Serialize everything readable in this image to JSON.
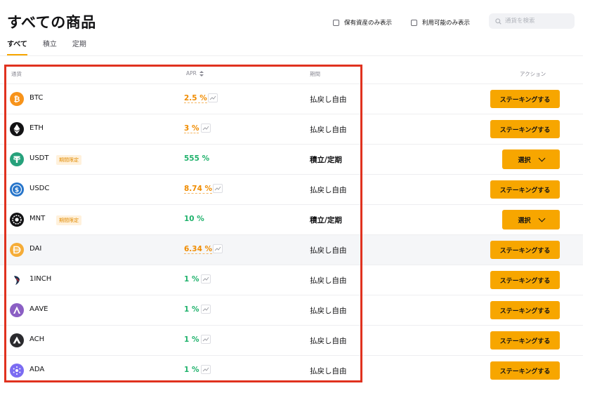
{
  "page": {
    "title": "すべての商品",
    "tabs": [
      {
        "label": "すべて",
        "active": true
      },
      {
        "label": "積立",
        "active": false
      },
      {
        "label": "定期",
        "active": false
      }
    ]
  },
  "filters": {
    "holdings_only": "保有資産のみ表示",
    "available_only": "利用可能のみ表示"
  },
  "search": {
    "placeholder": "通貨を検索"
  },
  "table": {
    "columns": {
      "currency": "通貨",
      "apr": "APR",
      "period": "期間",
      "action": "アクション"
    },
    "rows": [
      {
        "symbol": "BTC",
        "badge": "",
        "apr": "2.5 %",
        "apr_color": "orange",
        "period": "払戻し自由",
        "period_bold": false,
        "action": "ステーキングする",
        "action_type": "stake",
        "coin_color": "#f7931a",
        "icon": "btc-icon"
      },
      {
        "symbol": "ETH",
        "badge": "",
        "apr": "3 %",
        "apr_color": "orange",
        "period": "払戻し自由",
        "period_bold": false,
        "action": "ステーキングする",
        "action_type": "stake",
        "coin_color": "#121214",
        "icon": "eth-icon"
      },
      {
        "symbol": "USDT",
        "badge": "期間限定",
        "apr": "555 %",
        "apr_color": "green",
        "period": "積立/定期",
        "period_bold": true,
        "action": "選択",
        "action_type": "select",
        "coin_color": "#26a17b",
        "icon": "usdt-icon"
      },
      {
        "symbol": "USDC",
        "badge": "",
        "apr": "8.74 %",
        "apr_color": "orange",
        "period": "払戻し自由",
        "period_bold": false,
        "action": "ステーキングする",
        "action_type": "stake",
        "coin_color": "#2775ca",
        "icon": "usdc-icon"
      },
      {
        "symbol": "MNT",
        "badge": "期間限定",
        "apr": "10 %",
        "apr_color": "green",
        "period": "積立/定期",
        "period_bold": true,
        "action": "選択",
        "action_type": "select",
        "coin_color": "#121214",
        "icon": "mnt-icon"
      },
      {
        "symbol": "DAI",
        "badge": "",
        "apr": "6.34 %",
        "apr_color": "orange",
        "period": "払戻し自由",
        "period_bold": false,
        "action": "ステーキングする",
        "action_type": "stake",
        "coin_color": "#f5ac37",
        "icon": "dai-icon"
      },
      {
        "symbol": "1INCH",
        "badge": "",
        "apr": "1 %",
        "apr_color": "green",
        "period": "払戻し自由",
        "period_bold": false,
        "action": "ステーキングする",
        "action_type": "stake",
        "coin_color": "#1b314f",
        "icon": "1inch-icon"
      },
      {
        "symbol": "AAVE",
        "badge": "",
        "apr": "1 %",
        "apr_color": "green",
        "period": "払戻し自由",
        "period_bold": false,
        "action": "ステーキングする",
        "action_type": "stake",
        "coin_color": "#8b5fc4",
        "icon": "aave-icon"
      },
      {
        "symbol": "ACH",
        "badge": "",
        "apr": "1 %",
        "apr_color": "green",
        "period": "払戻し自由",
        "period_bold": false,
        "action": "ステーキングする",
        "action_type": "stake",
        "coin_color": "#2a2a2e",
        "icon": "ach-icon"
      },
      {
        "symbol": "ADA",
        "badge": "",
        "apr": "1 %",
        "apr_color": "green",
        "period": "払戻し自由",
        "period_bold": false,
        "action": "ステーキングする",
        "action_type": "stake",
        "coin_color": "#7b6cf2",
        "icon": "ada-icon"
      }
    ]
  },
  "colors": {
    "accent": "#f7a600",
    "apr_orange": "#f08c00",
    "apr_green": "#20b26c",
    "highlight_border": "#e0321f"
  }
}
